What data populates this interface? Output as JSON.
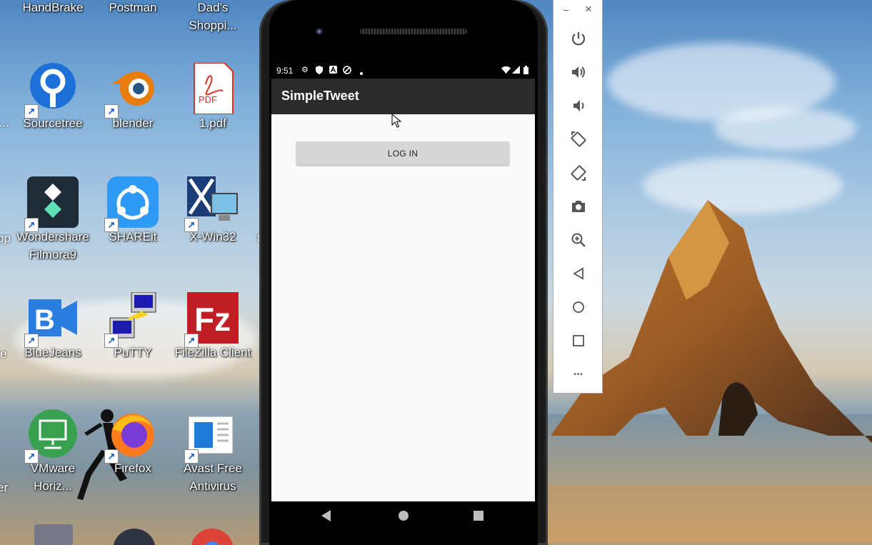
{
  "desktop": {
    "icons": [
      {
        "label": "HandBrake"
      },
      {
        "label": "Postman"
      },
      {
        "label": "Dad's\nShoppi..."
      },
      {
        "label": "Sourcetree"
      },
      {
        "label": "blender"
      },
      {
        "label": "1.pdf"
      },
      {
        "label": "Wondershare\nFilmora9"
      },
      {
        "label": "SHAREit"
      },
      {
        "label": "X-Win32"
      },
      {
        "label": "BlueJeans"
      },
      {
        "label": "PuTTY"
      },
      {
        "label": "FileZilla Client"
      },
      {
        "label": "VMware\nHoriz..."
      },
      {
        "label": "Firefox"
      },
      {
        "label": "Avast Free\nAntivirus"
      }
    ],
    "edge_labels": [
      "...",
      "pp",
      "e",
      "er",
      "8"
    ],
    "pdf_badge": "PDF"
  },
  "phone": {
    "status": {
      "time": "9:51",
      "left_icons": [
        "gear-icon",
        "shield-icon",
        "a-icon",
        "vpn-icon",
        "dot-icon"
      ],
      "right_icons": [
        "wifi-icon",
        "signal-icon",
        "battery-icon"
      ]
    },
    "app": {
      "title": "SimpleTweet",
      "login_label": "LOG IN"
    },
    "nav": [
      "back-icon",
      "home-icon",
      "recents-icon"
    ]
  },
  "toolbar": {
    "minimize": "–",
    "close": "×",
    "buttons": [
      "power-icon",
      "volume-up-icon",
      "volume-down-icon",
      "rotate-left-icon",
      "rotate-right-icon",
      "camera-icon",
      "zoom-icon",
      "back-icon",
      "home-icon",
      "overview-icon",
      "more-icon"
    ],
    "more": "•••"
  }
}
